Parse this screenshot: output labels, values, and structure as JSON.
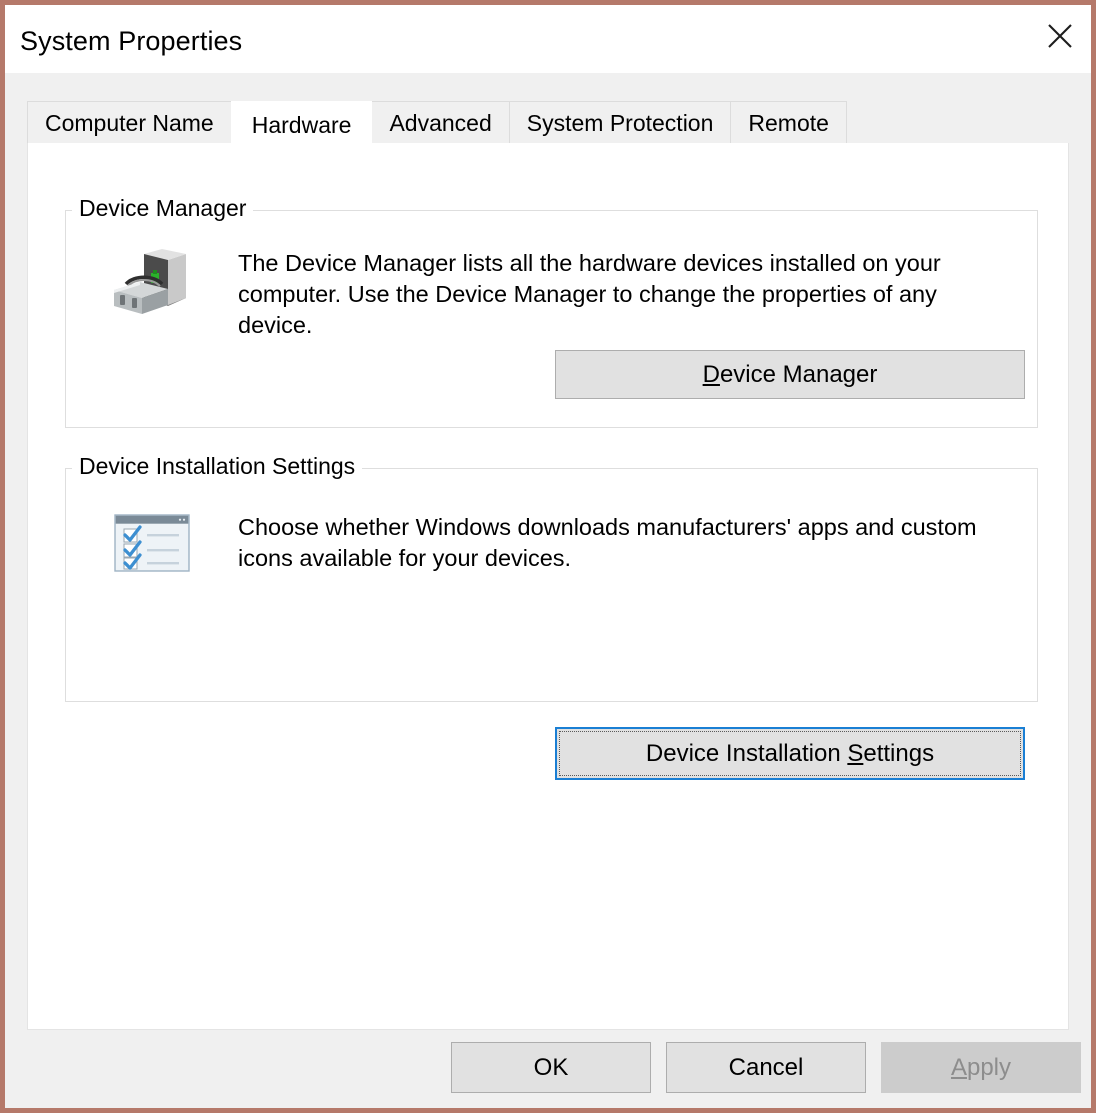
{
  "window": {
    "title": "System Properties",
    "close_icon": "close-icon",
    "border_color": "#b5796a",
    "titlebar_background": "#ffffff"
  },
  "tabs": [
    {
      "label": "Computer Name",
      "active": false
    },
    {
      "label": "Hardware",
      "active": true
    },
    {
      "label": "Advanced",
      "active": false
    },
    {
      "label": "System Protection",
      "active": false
    },
    {
      "label": "Remote",
      "active": false
    }
  ],
  "groups": [
    {
      "label": "Device Manager",
      "icon": "computer-tower-toolbox-icon",
      "description": "The Device Manager lists all the hardware devices installed on your computer. Use the Device Manager to change the properties of any device.",
      "button": {
        "label": "Device Manager",
        "accel_char": "D",
        "accel_prefix": "",
        "accel_suffix": "evice Manager",
        "focused": false,
        "disabled": false
      }
    },
    {
      "label": "Device Installation Settings",
      "icon": "checklist-window-icon",
      "description": "Choose whether Windows downloads manufacturers' apps and custom icons available for your devices.",
      "button": {
        "label": "Device Installation Settings",
        "accel_char": "S",
        "accel_prefix": "Device Installation ",
        "accel_suffix": "ettings",
        "focused": true,
        "disabled": false
      }
    }
  ],
  "footer": {
    "ok": {
      "label": "OK",
      "disabled": false
    },
    "cancel": {
      "label": "Cancel",
      "disabled": false
    },
    "apply": {
      "label": "Apply",
      "accel_char": "A",
      "accel_prefix": "",
      "accel_suffix": "pply",
      "disabled": true
    }
  },
  "colors": {
    "window_border": "#b5796a",
    "panel_background": "#ffffff",
    "chrome_background": "#f0f0f0",
    "button_face": "#e1e1e1",
    "button_border": "#adadad",
    "focus_border": "#1a7fd4",
    "disabled_face": "#cccccc",
    "disabled_text": "#8d8d8d",
    "groupbox_border": "#dedede",
    "check_blue": "#3d8fd1"
  }
}
